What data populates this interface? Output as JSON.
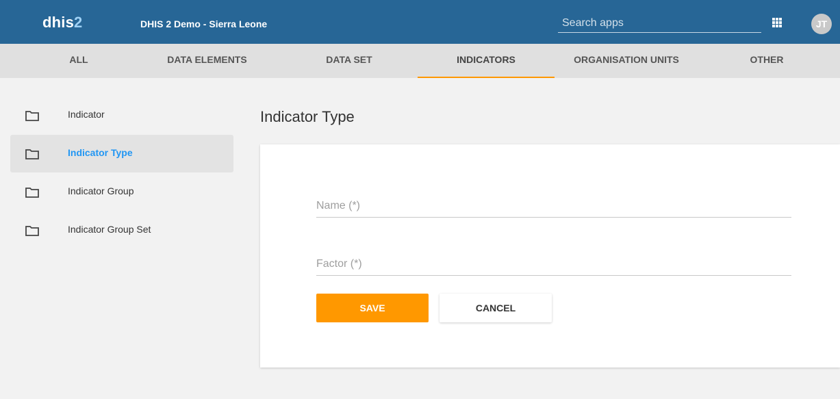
{
  "header": {
    "logo_text": "dhis",
    "logo_num": "2",
    "instance_title": "DHIS 2 Demo - Sierra Leone",
    "search_placeholder": "Search apps",
    "avatar_initials": "JT"
  },
  "tabs": [
    {
      "label": "ALL"
    },
    {
      "label": "DATA ELEMENTS"
    },
    {
      "label": "DATA SET"
    },
    {
      "label": "INDICATORS",
      "active": true
    },
    {
      "label": "ORGANISATION UNITS"
    },
    {
      "label": "OTHER"
    }
  ],
  "sidebar": {
    "items": [
      {
        "label": "Indicator",
        "icon": "folder-icon"
      },
      {
        "label": "Indicator Type",
        "icon": "folder-icon",
        "active": true
      },
      {
        "label": "Indicator Group",
        "icon": "folder-icon"
      },
      {
        "label": "Indicator Group Set",
        "icon": "folder-icon"
      }
    ]
  },
  "main": {
    "title": "Indicator Type",
    "form": {
      "name_placeholder": "Name (*)",
      "factor_placeholder": "Factor (*)",
      "save_label": "SAVE",
      "cancel_label": "CANCEL"
    }
  },
  "colors": {
    "header": "#276696",
    "accent": "#ff9800",
    "active_link": "#2196f3"
  }
}
